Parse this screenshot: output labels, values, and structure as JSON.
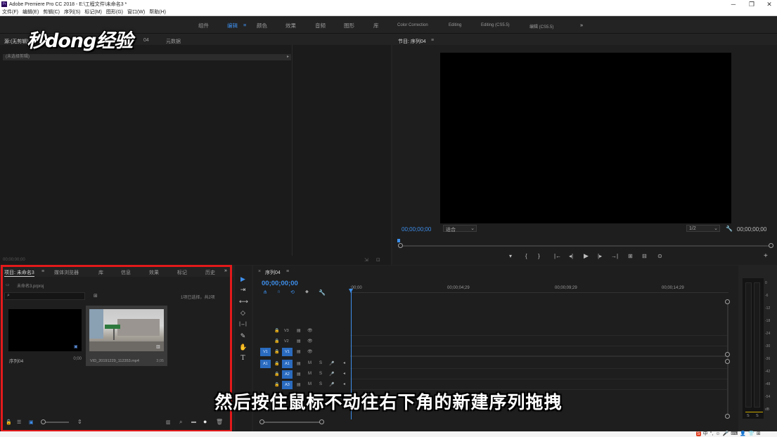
{
  "window": {
    "title": "Adobe Premiere Pro CC 2018 - E:\\工程文件\\未命名3 *",
    "app_icon": "Pr",
    "minimize": "─",
    "maximize": "❐",
    "close": "✕"
  },
  "menu": [
    "文件(F)",
    "编辑(E)",
    "剪辑(C)",
    "序列(S)",
    "标记(M)",
    "图形(G)",
    "窗口(W)",
    "帮助(H)"
  ],
  "workspaces": {
    "items": [
      "组件",
      "编辑",
      "颜色",
      "效果",
      "音频",
      "图形",
      "库",
      "Color Correction",
      "Editing",
      "Editing (CS5.5)",
      "编辑 (CS5.5)"
    ],
    "active_menu": "≡",
    "more": "»"
  },
  "watermark": "秒dong经验",
  "source_panel": {
    "tab_source": "源:(无剪辑)",
    "tab_mixer": "04",
    "tab_metadata": "元数据",
    "clip_bar": "(未选择剪辑)",
    "timecode": "00;00;00;00"
  },
  "program_panel": {
    "title": "节目: 序列04",
    "menu": "≡",
    "timecode_left": "00;00;00;00",
    "fit": "适合",
    "resolution": "1/2",
    "timecode_right": "00;00;00;00",
    "controls": [
      "▾",
      "{",
      "}",
      "|←",
      "◂|",
      "▶",
      "|▸",
      "→|",
      "⊞",
      "⊟",
      "⊙"
    ],
    "add": "+"
  },
  "project_panel": {
    "tabs": [
      "项目: 未命名3",
      "媒体浏览器",
      "库",
      "信息",
      "效果",
      "标记",
      "历史"
    ],
    "tab_menu": "≡",
    "more": "»",
    "project_file": "未命名3.prproj",
    "search_placeholder": "",
    "selection_info": "1项已选择，共2项",
    "items": [
      {
        "name": "序列04",
        "duration": "0;00"
      },
      {
        "name": "VID_20191229_112353.mp4",
        "duration": "3;05"
      }
    ],
    "bottom_icons": [
      "lock-icon",
      "list-view-icon",
      "icon-view-icon",
      "zoom-slider",
      "sort-icon",
      "automate-icon",
      "find-icon",
      "new-bin-icon",
      "new-item-icon",
      "delete-icon"
    ]
  },
  "tools": [
    "▶",
    "⇥",
    "⟷",
    "◇",
    "|↔|",
    "✎",
    "✋",
    "T"
  ],
  "timeline": {
    "title": "序列04",
    "menu": "≡",
    "timecode": "00;00;00;00",
    "ruler": [
      ":00;00",
      "00;00;04;29",
      "00;00;09;29",
      "00;00;14;29"
    ],
    "video_tracks": [
      {
        "label": "V3",
        "target": ""
      },
      {
        "label": "V2",
        "target": ""
      },
      {
        "label": "V1",
        "target": "V1"
      }
    ],
    "audio_tracks": [
      {
        "label": "A1",
        "target": "A1"
      },
      {
        "label": "A2",
        "target": ""
      },
      {
        "label": "A3",
        "target": ""
      }
    ],
    "audio_buttons": {
      "mute": "M",
      "solo": "S"
    }
  },
  "audio_meter": {
    "scale": [
      "0",
      "-6",
      "-12",
      "-18",
      "-24",
      "-30",
      "-36",
      "-42",
      "-48",
      "-54",
      "dB"
    ],
    "solo": [
      "S",
      "S"
    ]
  },
  "subtitle": "然后按住鼠标不动往右下角的新建序列拖拽",
  "colors": {
    "accent": "#3d8eea",
    "highlight_frame": "#e3191b",
    "panel_bg": "#1e1e1e",
    "chrome_bg": "#232323"
  }
}
